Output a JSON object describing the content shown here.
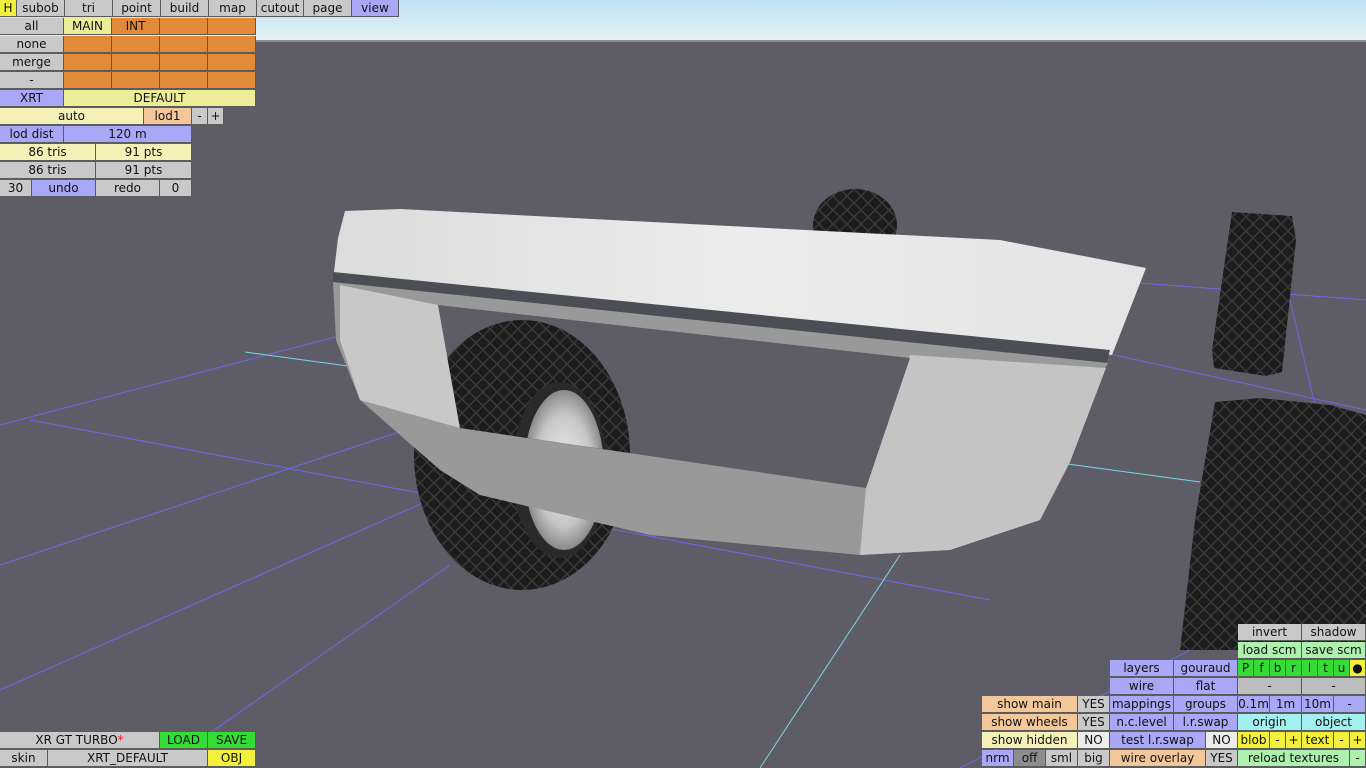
{
  "top_menu": {
    "h": "H",
    "items": [
      "subob",
      "tri",
      "point",
      "build",
      "map",
      "cutout",
      "page",
      "view"
    ]
  },
  "selection": {
    "all": "all",
    "none": "none",
    "merge": "merge",
    "dash": "-",
    "main": "MAIN",
    "int": "INT"
  },
  "car": {
    "code": "XRT",
    "config": "DEFAULT",
    "auto": "auto",
    "lod": "lod1",
    "minus": "-",
    "plus": "+",
    "lod_dist_label": "lod dist",
    "lod_dist_value": "120 m",
    "tris1": "86 tris",
    "pts1": "91 pts",
    "tris2": "86 tris",
    "pts2": "91 pts",
    "undo_count": "30",
    "undo": "undo",
    "redo": "redo",
    "redo_count": "0"
  },
  "bottom_left": {
    "name": "XR GT TURBO",
    "modified": "*",
    "load": "LOAD",
    "save": "SAVE",
    "skin": "skin",
    "skin_name": "XRT_DEFAULT",
    "obj": "OBJ"
  },
  "show": {
    "main": "show main",
    "main_val": "YES",
    "wheels": "show wheels",
    "wheels_val": "YES",
    "hidden": "show hidden",
    "hidden_val": "NO",
    "nrm": "nrm",
    "off": "off",
    "sml": "sml",
    "big": "big"
  },
  "view_opts": {
    "layers": "layers",
    "gouraud": "gouraud",
    "wire": "wire",
    "flat": "flat",
    "mappings": "mappings",
    "groups": "groups",
    "nclevel": "n.c.level",
    "lrswap": "l.r.swap",
    "test_lrswap": "test l.r.swap",
    "test_lrswap_val": "NO",
    "wire_overlay": "wire overlay",
    "wire_overlay_val": "YES"
  },
  "right_panel": {
    "invert": "invert",
    "shadow": "shadow",
    "load_scm": "load scm",
    "save_scm": "save scm",
    "letters": [
      "P",
      "f",
      "b",
      "r",
      "l",
      "t",
      "u",
      "●"
    ],
    "dash1": "-",
    "dash2": "-",
    "d01": "0.1m",
    "d1": "1m",
    "d10": "10m",
    "dmin": "-",
    "origin": "origin",
    "object": "object",
    "blob": "blob",
    "blob_minus": "-",
    "blob_plus": "+",
    "text": "text",
    "text_minus": "-",
    "text_plus": "+",
    "reload": "reload textures",
    "reload_minus": "-"
  }
}
